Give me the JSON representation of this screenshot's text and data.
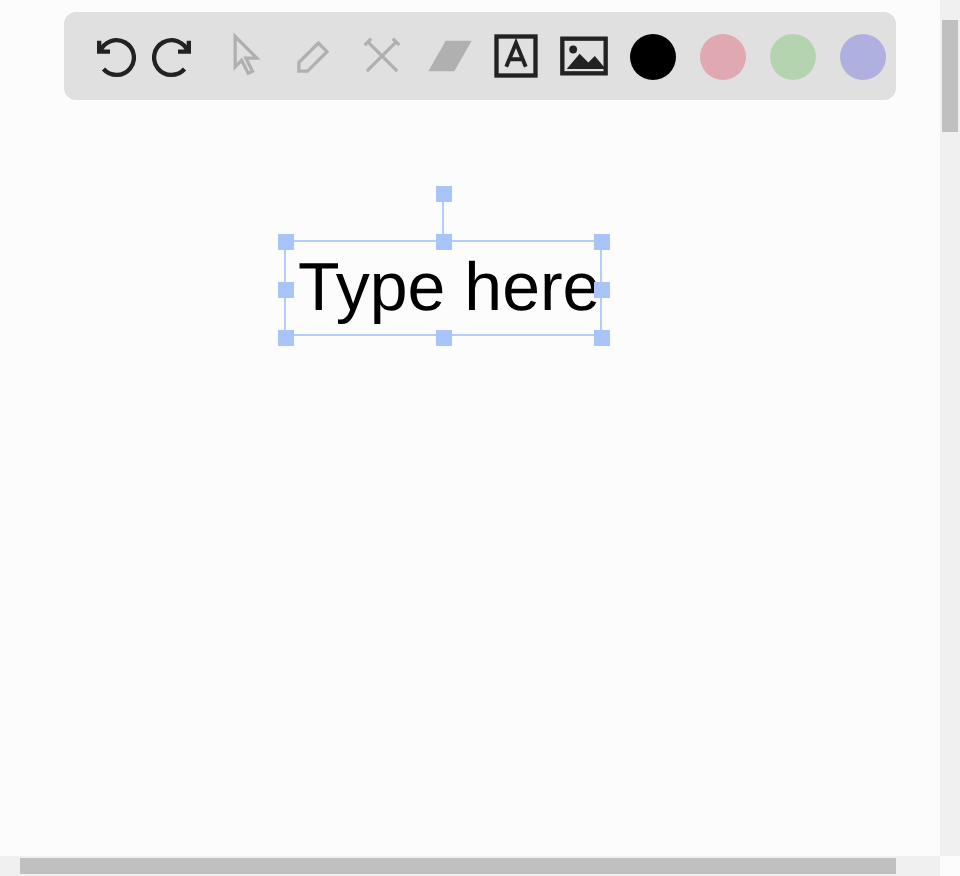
{
  "toolbar": {
    "tools": [
      {
        "kind": "undo",
        "disabled": false
      },
      {
        "kind": "redo",
        "disabled": false
      },
      {
        "kind": "pointer",
        "disabled": true
      },
      {
        "kind": "pencil",
        "disabled": true
      },
      {
        "kind": "tools",
        "disabled": true
      },
      {
        "kind": "eraser",
        "disabled": true
      },
      {
        "kind": "text",
        "disabled": false
      },
      {
        "kind": "image",
        "disabled": false
      }
    ],
    "colors": [
      {
        "color": "#000000"
      },
      {
        "color": "#e0a8b0"
      },
      {
        "color": "#b4d4b0"
      },
      {
        "color": "#b0b0e0"
      }
    ]
  },
  "canvas": {
    "text_box": {
      "text": "Type here",
      "selected": true
    }
  }
}
